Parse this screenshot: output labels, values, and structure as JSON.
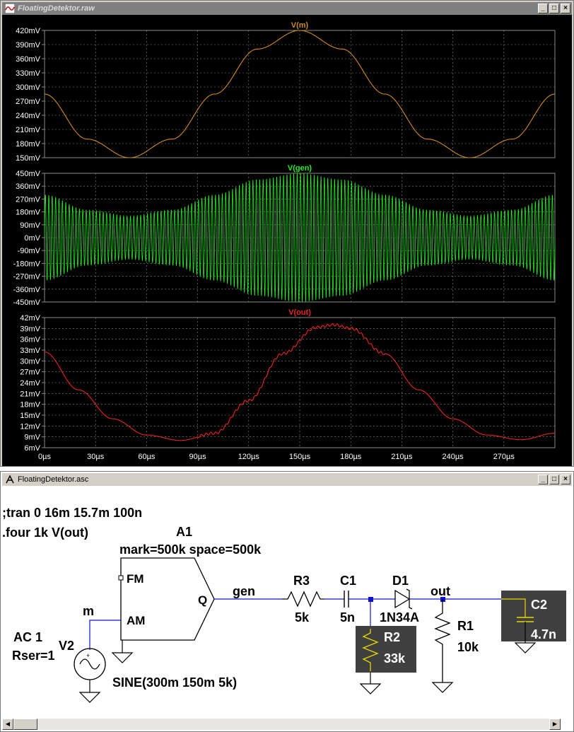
{
  "waveform_window": {
    "title": "FloatingDetektor.raw",
    "buttons": {
      "minimize": "_",
      "maximize": "□",
      "close": "×"
    }
  },
  "schematic_window": {
    "title": "FloatingDetektor.asc",
    "buttons": {
      "minimize": "_",
      "maximize": "□",
      "close": "×"
    }
  },
  "colors": {
    "vm": "#d08a1a",
    "vgen": "#22ee22",
    "vout": "#ee2222",
    "grid": "#8a8a8a",
    "wire": "#1010d0",
    "component": "#000000",
    "plot_bg": "#000000",
    "label": "#ffffff"
  },
  "chart_data": [
    {
      "type": "line",
      "title": "V(m)",
      "x": [
        0,
        25,
        50,
        75,
        100,
        125,
        150,
        175,
        200,
        225,
        250,
        275,
        300
      ],
      "series": [
        {
          "name": "V(m)",
          "values": [
            300,
            194,
            150,
            194,
            300,
            406,
            450,
            406,
            300,
            194,
            150,
            194,
            300
          ]
        }
      ],
      "yticks": [
        "420mV",
        "390mV",
        "360mV",
        "330mV",
        "300mV",
        "270mV",
        "240mV",
        "210mV",
        "180mV",
        "150mV"
      ],
      "ylim": [
        150,
        450
      ],
      "xlim": [
        0,
        300
      ],
      "grid": true
    },
    {
      "type": "line",
      "title": "V(gen)",
      "x": [
        0,
        25,
        50,
        75,
        100,
        125,
        150,
        175,
        200,
        225,
        250,
        275,
        300
      ],
      "series": [
        {
          "name": "V(gen)",
          "values": [
            300,
            194,
            150,
            194,
            300,
            406,
            450,
            406,
            300,
            194,
            150,
            194,
            300
          ]
        }
      ],
      "carrier_cycles": 150,
      "yticks": [
        "450mV",
        "360mV",
        "270mV",
        "180mV",
        "90mV",
        "0mV",
        "-90mV",
        "-180mV",
        "-270mV",
        "-360mV",
        "-450mV"
      ],
      "ylim": [
        -450,
        450
      ],
      "xlim": [
        0,
        300
      ],
      "grid": true
    },
    {
      "type": "line",
      "title": "V(out)",
      "x": [
        0,
        20,
        40,
        60,
        80,
        100,
        120,
        140,
        160,
        170,
        180,
        200,
        220,
        240,
        260,
        280,
        300
      ],
      "series": [
        {
          "name": "V(out)",
          "values": [
            32.5,
            22,
            14,
            9.5,
            8,
            10,
            19,
            32,
            39.3,
            40,
            39,
            32,
            22,
            14,
            9.5,
            8.2,
            10
          ]
        }
      ],
      "yticks": [
        "42mV",
        "39mV",
        "36mV",
        "33mV",
        "30mV",
        "27mV",
        "24mV",
        "21mV",
        "18mV",
        "15mV",
        "12mV",
        "9mV",
        "6mV"
      ],
      "xticks": [
        "0µs",
        "30µs",
        "60µs",
        "90µs",
        "120µs",
        "150µs",
        "180µs",
        "210µs",
        "240µs",
        "270µs"
      ],
      "ylim": [
        6,
        42
      ],
      "xlim": [
        0,
        300
      ],
      "grid": true
    }
  ],
  "schematic": {
    "directive_tran": ";tran 0 16m 15.7m 100n",
    "directive_four": ".four 1k V(out)",
    "a1_name": "A1",
    "a1_params": "mark=500k space=500k",
    "a1_pin_fm": "FM",
    "a1_pin_am": "AM",
    "a1_pin_q": "Q",
    "net_m": "m",
    "net_gen": "gen",
    "net_out": "out",
    "r3_name": "R3",
    "r3_value": "5k",
    "c1_name": "C1",
    "c1_value": "5n",
    "d1_name": "D1",
    "d1_value": "1N34A",
    "r2_name": "R2",
    "r2_value": "33k",
    "r1_name": "R1",
    "r1_value": "10k",
    "c2_name": "C2",
    "c2_value": "4.7n",
    "v2_name": "V2",
    "v2_ac": "AC 1",
    "v2_rser": "Rser=1",
    "v2_value": "SINE(300m 150m 5k)"
  }
}
